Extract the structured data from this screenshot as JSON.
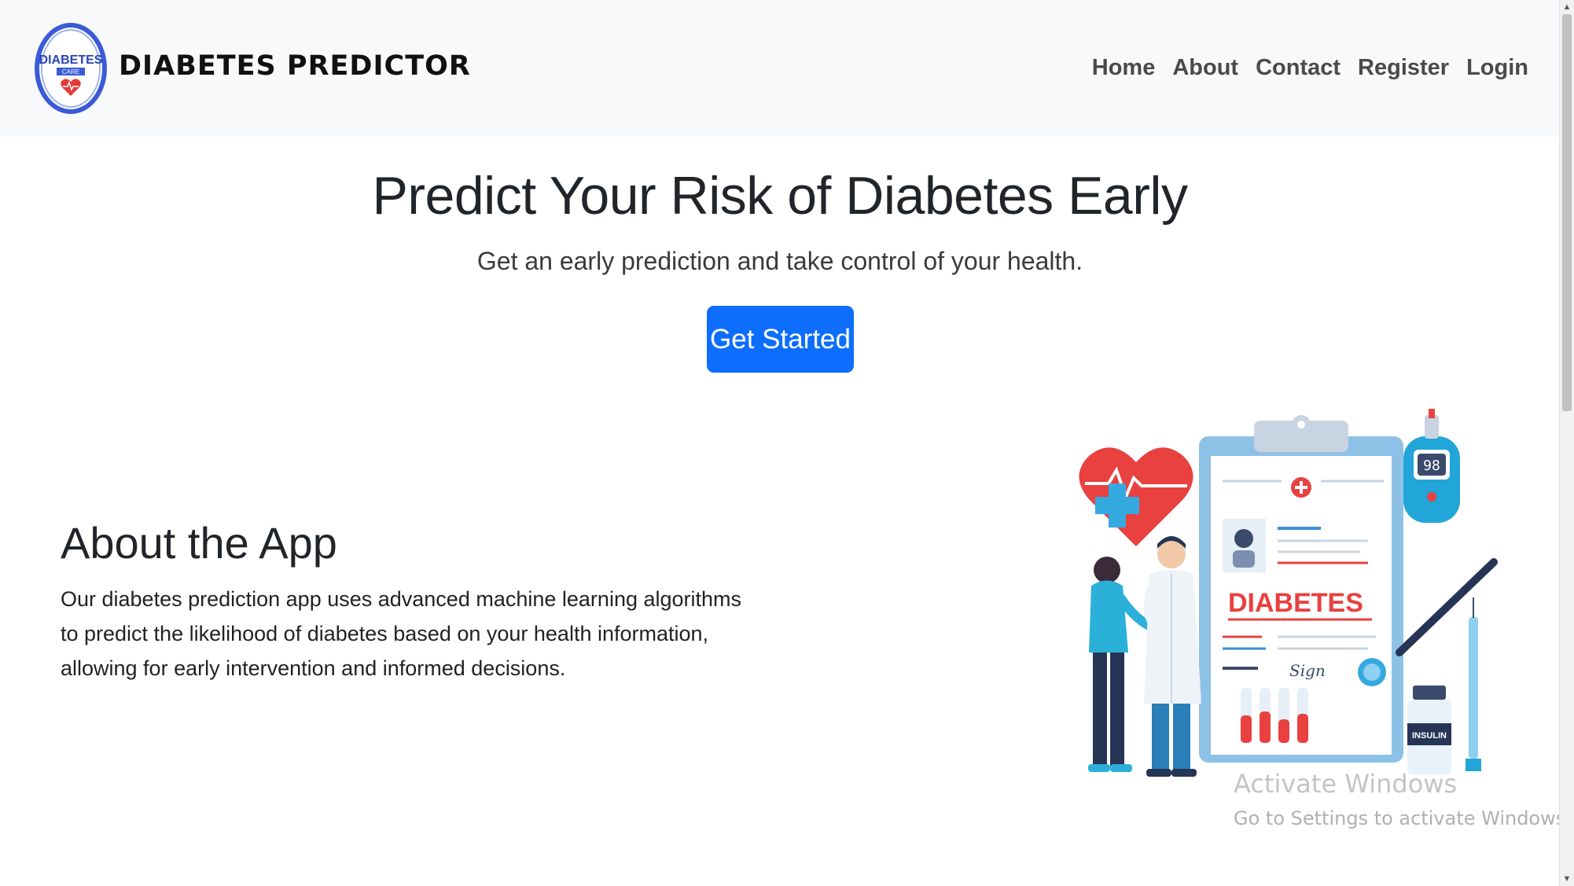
{
  "navbar": {
    "logo": {
      "top_text": "DIABETES",
      "bottom_text": "CARE"
    },
    "brand": "DIABETES PREDICTOR",
    "links": [
      "Home",
      "About",
      "Contact",
      "Register",
      "Login"
    ]
  },
  "hero": {
    "title": "Predict Your Risk of Diabetes Early",
    "subtitle": "Get an early prediction and take control of your health.",
    "cta_label": "Get Started"
  },
  "about": {
    "title": "About the App",
    "text": "Our diabetes prediction app uses advanced machine learning algorithms to predict the likelihood of diabetes based on your health information, allowing for early intervention and informed decisions."
  },
  "illustration": {
    "clipboard_label": "DIABETES",
    "meter_reading": "98",
    "signature": "Sign",
    "vial_label": "INSULIN"
  },
  "watermark": {
    "title": "Activate Windows",
    "subtitle": "Go to Settings to activate Windows."
  },
  "colors": {
    "primary": "#0d6efd",
    "navbar_bg": "#f8f9fa",
    "accent_red": "#e8413f",
    "accent_teal": "#22a5d8"
  }
}
